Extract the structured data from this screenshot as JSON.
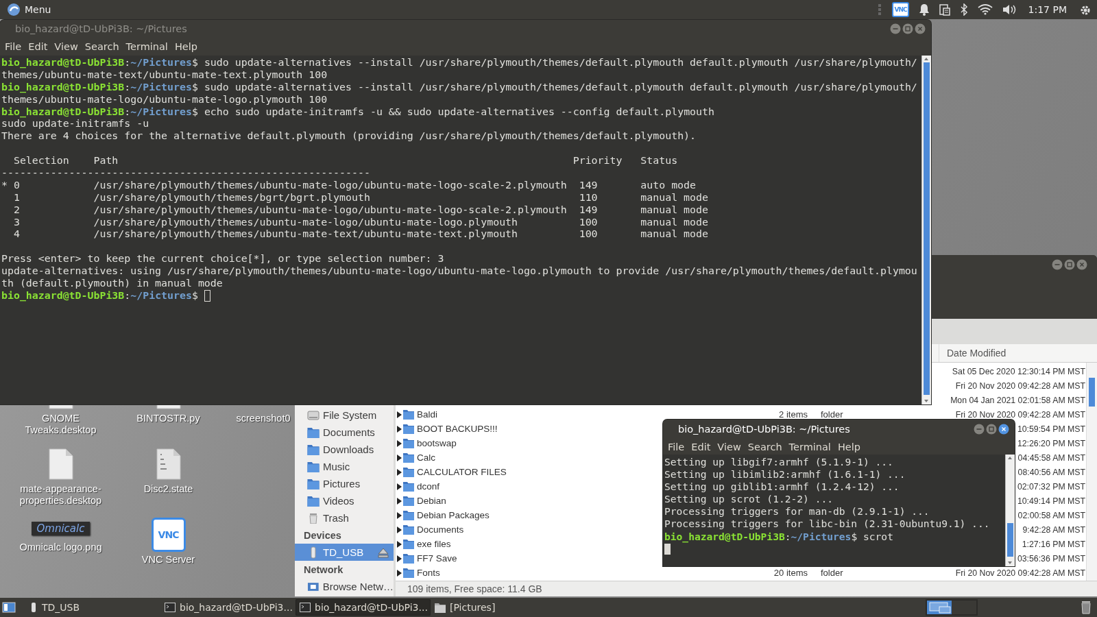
{
  "top_panel": {
    "menu_label": "Menu",
    "tray_logo": "VNC",
    "clock": "1:17 PM"
  },
  "desktop_icons": [
    {
      "label": "GNOME Tweaks.desktop",
      "kind": "file"
    },
    {
      "label": "mate-appearance-properties.desktop",
      "kind": "file"
    },
    {
      "label": "Omnicalc logo.png",
      "kind": "logo",
      "thumbnail_text": "Omnicalc"
    },
    {
      "label": "BINTOSTR.py",
      "kind": "file"
    },
    {
      "label": "Disc2.state",
      "kind": "data"
    },
    {
      "label": "VNC Server",
      "kind": "vnc",
      "logo_text": "VNC"
    },
    {
      "label": "screenshot0",
      "kind": "image"
    }
  ],
  "file_manager": {
    "active": false,
    "sidebar": [
      {
        "label": "File System",
        "kind": "disk",
        "selected": false
      },
      {
        "label": "Documents",
        "kind": "folder",
        "selected": false
      },
      {
        "label": "Downloads",
        "kind": "folder",
        "selected": false
      },
      {
        "label": "Music",
        "kind": "folder",
        "selected": false
      },
      {
        "label": "Pictures",
        "kind": "folder",
        "selected": false
      },
      {
        "label": "Videos",
        "kind": "folder",
        "selected": false
      },
      {
        "label": "Trash",
        "kind": "trash",
        "selected": false
      },
      {
        "label": "Devices",
        "kind": "heading"
      },
      {
        "label": "TD_USB",
        "kind": "usb",
        "selected": true
      },
      {
        "label": "Network",
        "kind": "heading"
      },
      {
        "label": "Browse Netw…",
        "kind": "network",
        "selected": false
      }
    ],
    "columns": [
      "Date Modified"
    ],
    "rows": [
      {
        "date": "Sat 05 Dec 2020 12:30:14 PM MST"
      },
      {
        "date": "Fri 20 Nov 2020 09:42:28 AM MST"
      },
      {
        "date": "Mon 04 Jan 2021 02:01:58 AM MST"
      },
      {
        "name": "Baldi",
        "expanded": false,
        "size": "2 items",
        "type": "folder",
        "date": "Fri 20 Nov 2020 09:42:28 AM MST"
      },
      {
        "name": "BOOT BACKUPS!!!",
        "expanded": false,
        "date": "10:59:54 PM MST"
      },
      {
        "name": "bootswap",
        "expanded": false,
        "date": "12:26:20 PM MST"
      },
      {
        "name": "Calc",
        "expanded": false,
        "date": "04:45:58 AM MST"
      },
      {
        "name": "CALCULATOR FILES",
        "expanded": false,
        "date": "08:40:56 AM MST"
      },
      {
        "name": "dconf",
        "expanded": false,
        "date": "02:07:32 PM MST"
      },
      {
        "name": "Debian",
        "expanded": false,
        "date": "10:49:14 PM MST"
      },
      {
        "name": "Debian Packages",
        "expanded": false,
        "date": "02:00:58 AM MST"
      },
      {
        "name": "Documents",
        "expanded": false,
        "date": "9:42:28 AM MST"
      },
      {
        "name": "exe files",
        "expanded": false,
        "date": "1:27:16 PM MST"
      },
      {
        "name": "FF7 Save",
        "expanded": false,
        "date": "03:56:36 PM MST"
      },
      {
        "name": "Fonts",
        "expanded": false,
        "size": "20 items",
        "type": "folder",
        "date": "Fri 20 Nov 2020 09:42:28 AM MST"
      }
    ],
    "status": "109 items, Free space: 11.4 GB"
  },
  "main_terminal": {
    "title": "bio_hazard@tD-UbPi3B: ~/Pictures",
    "active": false,
    "menu": [
      "File",
      "Edit",
      "View",
      "Search",
      "Terminal",
      "Help"
    ],
    "lines": [
      {
        "kind": "prompt",
        "user": "bio_hazard@tD-UbPi3B",
        "separator": ":",
        "path": "~/Pictures",
        "prompt_end": "$",
        "command": "sudo update-alternatives --install /usr/share/plymouth/themes/default.plymouth default.plymouth /usr/share/plymouth/",
        "cursor": false
      },
      {
        "kind": "output",
        "text": "themes/ubuntu-mate-text/ubuntu-mate-text.plymouth 100"
      },
      {
        "kind": "prompt",
        "user": "bio_hazard@tD-UbPi3B",
        "separator": ":",
        "path": "~/Pictures",
        "prompt_end": "$",
        "command": "sudo update-alternatives --install /usr/share/plymouth/themes/default.plymouth default.plymouth /usr/share/plymouth/",
        "cursor": false
      },
      {
        "kind": "output",
        "text": "themes/ubuntu-mate-logo/ubuntu-mate-logo.plymouth 100"
      },
      {
        "kind": "prompt",
        "user": "bio_hazard@tD-UbPi3B",
        "separator": ":",
        "path": "~/Pictures",
        "prompt_end": "$",
        "command": "echo sudo update-initramfs -u && sudo update-alternatives --config default.plymouth",
        "cursor": false
      },
      {
        "kind": "output",
        "text": "sudo update-initramfs -u"
      },
      {
        "kind": "output",
        "text": "There are 4 choices for the alternative default.plymouth (providing /usr/share/plymouth/themes/default.plymouth)."
      },
      {
        "kind": "blank",
        "cursor": false
      },
      {
        "kind": "table-header",
        "columns": [
          "Selection",
          "Path",
          "Priority",
          "Status"
        ]
      },
      {
        "kind": "output",
        "text": "------------------------------------------------------------"
      },
      {
        "kind": "table-row",
        "marker": "*",
        "selection": "0",
        "path": "/usr/share/plymouth/themes/ubuntu-mate-logo/ubuntu-mate-logo-scale-2.plymouth",
        "priority": "149",
        "status": "auto mode"
      },
      {
        "kind": "table-row",
        "selection": "1",
        "path": "/usr/share/plymouth/themes/bgrt/bgrt.plymouth",
        "priority": "110",
        "status": "manual mode"
      },
      {
        "kind": "table-row",
        "selection": "2",
        "path": "/usr/share/plymouth/themes/ubuntu-mate-logo/ubuntu-mate-logo-scale-2.plymouth",
        "priority": "149",
        "status": "manual mode"
      },
      {
        "kind": "table-row",
        "selection": "3",
        "path": "/usr/share/plymouth/themes/ubuntu-mate-logo/ubuntu-mate-logo.plymouth",
        "priority": "100",
        "status": "manual mode"
      },
      {
        "kind": "table-row",
        "selection": "4",
        "path": "/usr/share/plymouth/themes/ubuntu-mate-text/ubuntu-mate-text.plymouth",
        "priority": "100",
        "status": "manual mode"
      },
      {
        "kind": "blank",
        "cursor": false
      },
      {
        "kind": "output",
        "text": "Press <enter> to keep the current choice[*], or type selection number: 3"
      },
      {
        "kind": "output",
        "text": "update-alternatives: using /usr/share/plymouth/themes/ubuntu-mate-logo/ubuntu-mate-logo.plymouth to provide /usr/share/plymouth/themes/default.plymou"
      },
      {
        "kind": "output",
        "text": "th (default.plymouth) in manual mode"
      },
      {
        "kind": "prompt",
        "user": "bio_hazard@tD-UbPi3B",
        "separator": ":",
        "path": "~/Pictures",
        "prompt_end": "$",
        "cursor": true
      }
    ]
  },
  "small_terminal": {
    "title": "bio_hazard@tD-UbPi3B: ~/Pictures",
    "active": true,
    "menu": [
      "File",
      "Edit",
      "View",
      "Search",
      "Terminal",
      "Help"
    ],
    "lines": [
      {
        "kind": "output",
        "text": "Setting up libgif7:armhf (5.1.9-1) ..."
      },
      {
        "kind": "output",
        "text": "Setting up libimlib2:armhf (1.6.1-1) ..."
      },
      {
        "kind": "output",
        "text": "Setting up giblib1:armhf (1.2.4-12) ..."
      },
      {
        "kind": "output",
        "text": "Setting up scrot (1.2-2) ..."
      },
      {
        "kind": "output",
        "text": "Processing triggers for man-db (2.9.1-1) ..."
      },
      {
        "kind": "output",
        "text": "Processing triggers for libc-bin (2.31-0ubuntu9.1) ..."
      },
      {
        "kind": "prompt",
        "user": "bio_hazard@tD-UbPi3B",
        "separator": ":",
        "path": "~/Pictures",
        "prompt_end": "$",
        "command": "scrot",
        "cursor": false
      },
      {
        "kind": "blank",
        "cursor": true
      }
    ]
  },
  "taskbar": [
    {
      "label": "TD_USB",
      "kind": "usb",
      "selected": false
    },
    {
      "label": "bio_hazard@tD-UbPi3...",
      "kind": "terminal",
      "selected": false
    },
    {
      "label": "bio_hazard@tD-UbPi3...",
      "kind": "terminal",
      "selected": true
    },
    {
      "label": "[Pictures]",
      "kind": "folder",
      "selected": false
    }
  ]
}
